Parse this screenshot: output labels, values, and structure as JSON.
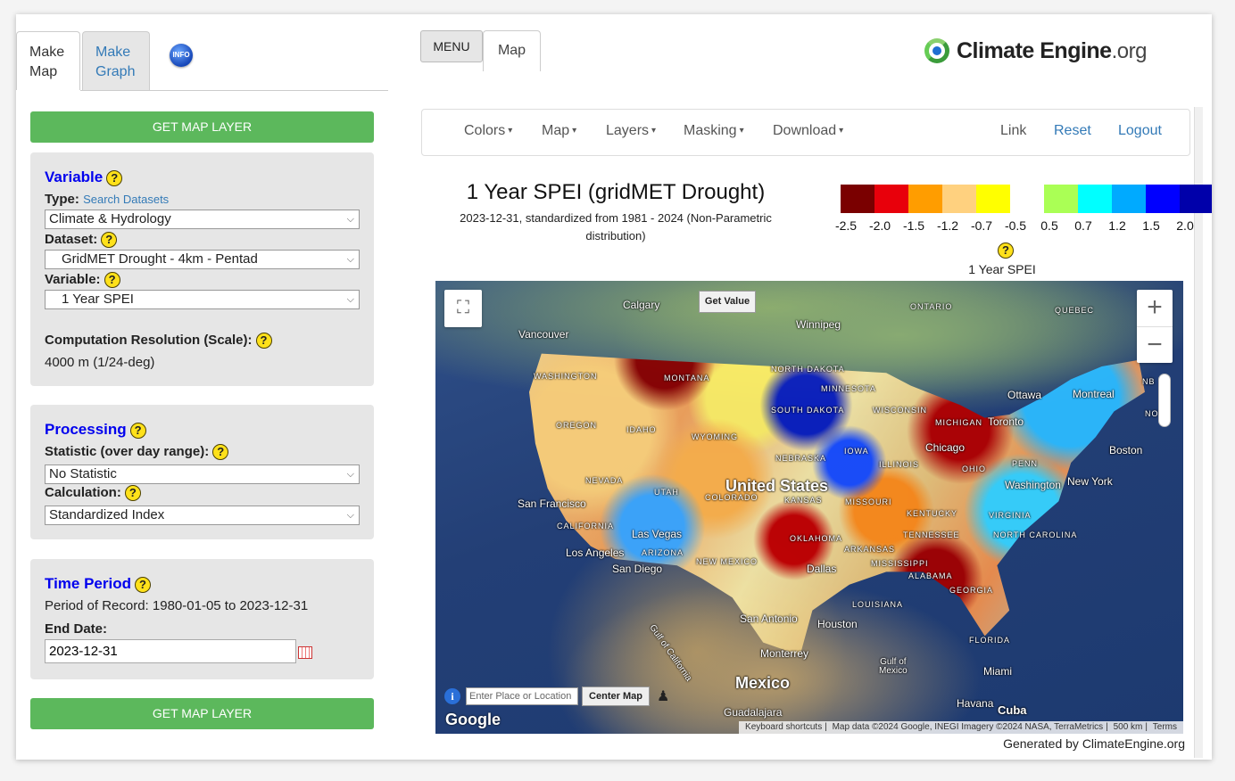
{
  "left_panel": {
    "tabs": [
      {
        "label": "Make\nMap",
        "line1": "Make",
        "line2": "Map"
      },
      {
        "label": "Make\nGraph",
        "line1": "Make",
        "line2": "Graph"
      }
    ],
    "info_icon": {
      "name": "info-icon",
      "label": "INFO"
    },
    "get_map_layer_label": "GET MAP LAYER",
    "variable_section": {
      "title": "Variable",
      "type_label": "Type:",
      "type_link": "Search Datasets",
      "type_value": "Climate & Hydrology",
      "dataset_label": "Dataset:",
      "dataset_value": "GridMET Drought - 4km - Pentad",
      "variable_label": "Variable:",
      "variable_value": "1 Year SPEI",
      "resolution_label": "Computation Resolution (Scale):",
      "resolution_value": "4000 m (1/24-deg)"
    },
    "processing_section": {
      "title": "Processing",
      "statistic_label": "Statistic (over day range):",
      "statistic_value": "No Statistic",
      "calculation_label": "Calculation:",
      "calculation_value": "Standardized Index"
    },
    "time_section": {
      "title": "Time Period",
      "period_text": "Period of Record: 1980-01-05 to 2023-12-31",
      "end_date_label": "End Date:",
      "end_date_value": "2023-12-31"
    }
  },
  "header": {
    "menu_label": "MENU",
    "map_tab_label": "Map",
    "logo_text": "Climate Engine",
    "logo_suffix": ".org"
  },
  "navbar": {
    "dropdowns": [
      "Colors",
      "Map",
      "Layers",
      "Masking",
      "Download"
    ],
    "link": "Link",
    "reset": "Reset",
    "logout": "Logout"
  },
  "map_header": {
    "title": "1 Year SPEI (gridMET Drought)",
    "subtitle": "2023-12-31, standardized from 1981 - 2024 (Non-Parametric distribution)",
    "legend_caption": "1 Year SPEI",
    "legend_colors": [
      "#7a0000",
      "#e8000b",
      "#ff9d00",
      "#ffd17f",
      "#ffff00",
      "#ffffff",
      "#aaff55",
      "#00ffff",
      "#00aaff",
      "#0000ff",
      "#0000aa"
    ],
    "legend_ticks": [
      "-2.5",
      "-2.0",
      "-1.5",
      "-1.2",
      "-0.7",
      "-0.5",
      "0.5",
      "0.7",
      "1.2",
      "1.5",
      "2.0"
    ]
  },
  "map": {
    "get_value_label": "Get Value",
    "zoom_in": "+",
    "zoom_out": "−",
    "place_placeholder": "Enter Place or Location",
    "center_map_label": "Center Map",
    "info_glyph": "i",
    "google_label": "Google",
    "attribution": [
      "Keyboard shortcuts",
      "Map data ©2024 Google, INEGI Imagery ©2024 NASA, TerraMetrics",
      "500 km",
      "Terms"
    ],
    "labels": {
      "calgary": "Calgary",
      "winnipeg": "Winnipeg",
      "vancouver": "Vancouver",
      "ontario": "ONTARIO",
      "quebec": "QUEBEC",
      "ottawa": "Ottawa",
      "montreal": "Montreal",
      "toronto": "Toronto",
      "boston": "Boston",
      "new_york": "New York",
      "chicago": "Chicago",
      "united_states": "United States",
      "san_francisco": "San Francisco",
      "las_vegas": "Las Vegas",
      "los_angeles": "Los Angeles",
      "san_diego": "San Diego",
      "dallas": "Dallas",
      "san_antonio": "San Antonio",
      "houston": "Houston",
      "monterrey": "Monterrey",
      "mexico": "Mexico",
      "gulf_of_mexico": "Gulf of\nMexico",
      "gulf_line1": "Gulf of",
      "gulf_line2": "Mexico",
      "miami": "Miami",
      "havana": "Havana",
      "cuba": "Cuba",
      "guadalajara": "Guadalajara",
      "gulf_of_california": "Gulf of California",
      "nb": "NB",
      "ns": "NOVA SC",
      "ns_short": "NOV",
      "washington": "WASHINGTON",
      "montana": "MONTANA",
      "north_dakota": "NORTH DAKOTA",
      "south_dakota": "SOUTH DAKOTA",
      "minnesota": "MINNESOTA",
      "wisconsin": "WISCONSIN",
      "oregon": "OREGON",
      "idaho": "IDAHO",
      "nevada": "NEVADA",
      "utah": "UTAH",
      "california": "CALIFORNIA",
      "arizona": "ARIZONA",
      "new_mexico": "NEW MEXICO",
      "kansas": "KANSAS",
      "oklahoma": "OKLAHOMA",
      "missouri": "MISSOURI",
      "illinois": "ILLINOIS",
      "ohio": "OHIO",
      "kentucky": "KENTUCKY",
      "tennessee": "TENNESSEE",
      "arkansas": "ARKANSAS",
      "alabama": "ALABAMA",
      "georgia": "GEORGIA",
      "louisiana": "LOUISIANA",
      "florida": "FLORIDA",
      "virginia": "VIRGINIA",
      "north_carolina": "NORTH CAROLINA",
      "mississippi": "MISSISSIPPI",
      "nebraska": "NEBRASKA",
      "iowa": "IOWA",
      "colorado": "COLORADO",
      "wyoming": "WYOMING",
      "michigan": "MICHIGAN",
      "pennsylvania": "PENN",
      "washington_dc": "Washington"
    }
  },
  "footer": {
    "generated": "Generated by ClimateEngine.org"
  }
}
